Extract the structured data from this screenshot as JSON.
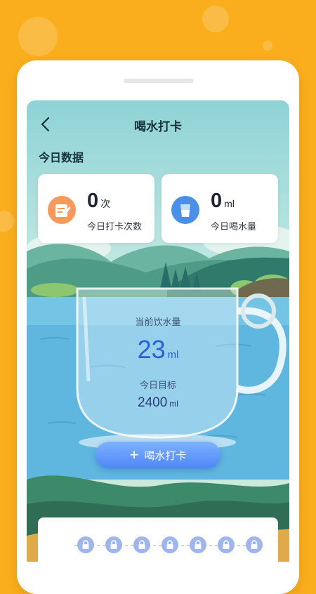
{
  "header": {
    "title": "喝水打卡"
  },
  "section": {
    "title": "今日数据"
  },
  "stats": [
    {
      "value": "0",
      "unit": "次",
      "label": "今日打卡次数",
      "icon": "clipboard-icon"
    },
    {
      "value": "0",
      "unit": "ml",
      "label": "今日喝水量",
      "icon": "water-cup-icon"
    }
  ],
  "cup": {
    "current_label": "当前饮水量",
    "current_value": "23",
    "current_unit": "ml",
    "goal_label": "今日目标",
    "goal_value": "2400",
    "goal_unit": "ml"
  },
  "action": {
    "checkin_label": "喝水打卡"
  },
  "progress": {
    "locked_slots": 7,
    "lock_icon": "lock-icon"
  },
  "colors": {
    "background": "#FBAE1D",
    "accent": "#4F86F7",
    "card_icon_orange": "#F59A5C",
    "card_icon_blue": "#4A90E6"
  }
}
